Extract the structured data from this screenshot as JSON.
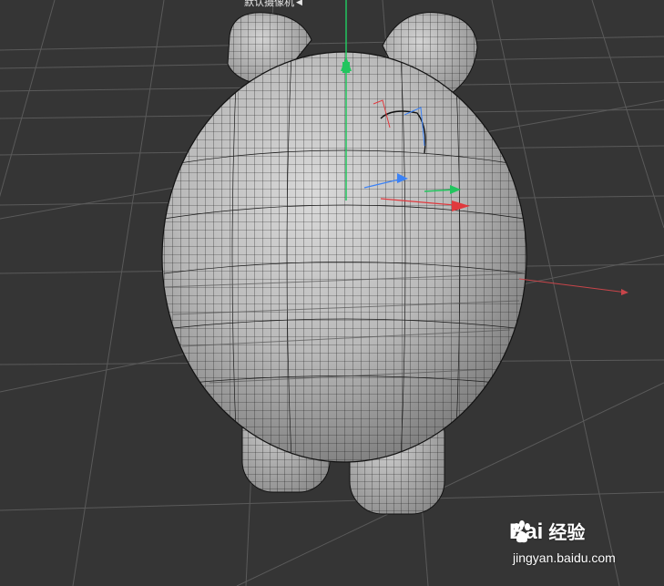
{
  "viewport": {
    "camera_label": "默认摄像机",
    "camera_icon": "camera-arrow-icon",
    "background_color": "#353535",
    "grid_color": "#5a5a5a",
    "model_color": "#c8c8c8",
    "wire_color": "#1a1a1a",
    "axis_colors": {
      "x": "#e0393e",
      "y": "#22c55e",
      "z": "#3b82f6"
    }
  },
  "watermark": {
    "brand_prefix": "Bai",
    "brand_suffix": "经验",
    "paw_icon": "paw-icon",
    "url": "jingyan.baidu.com"
  }
}
